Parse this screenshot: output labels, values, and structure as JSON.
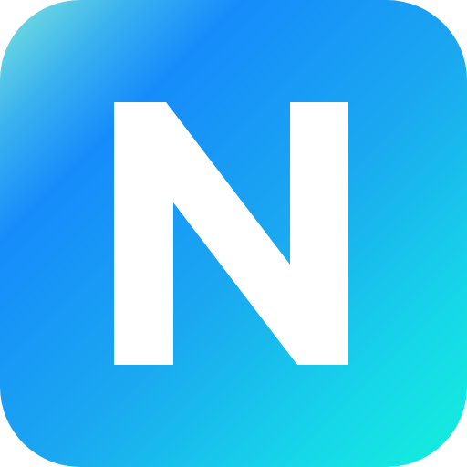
{
  "app_icon": {
    "letter": "N",
    "colors": {
      "gradient_start": "#7ee6dc",
      "gradient_mid": "#168cfb",
      "gradient_end": "#12f0dc",
      "letter": "#ffffff"
    }
  }
}
